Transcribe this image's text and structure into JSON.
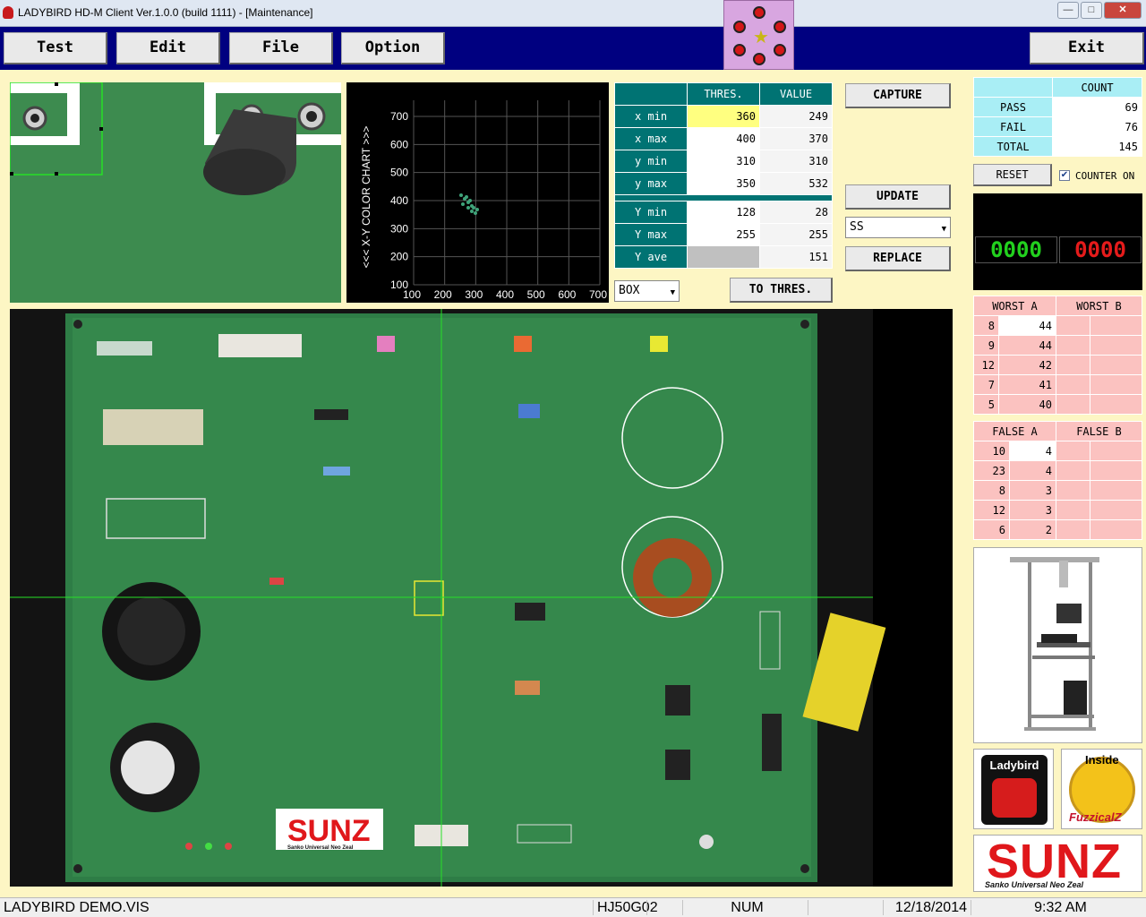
{
  "window": {
    "title": "LADYBIRD HD-M Client Ver.1.0.0  (build 1111) - [Maintenance]",
    "minimize": "—",
    "maximize": "□",
    "close": "✕"
  },
  "menu": {
    "test": "Test",
    "edit": "Edit",
    "file": "File",
    "option": "Option",
    "exit": "Exit"
  },
  "color_chart": {
    "ylabel": "<<<  X-Y COLOR CHART  >>>",
    "x_ticks": [
      "100",
      "200",
      "300",
      "400",
      "500",
      "600",
      "700"
    ],
    "y_ticks": [
      "700",
      "600",
      "500",
      "400",
      "300",
      "200",
      "100"
    ]
  },
  "thresholds": {
    "header_thres": "THRES.",
    "header_value": "VALUE",
    "rows_top": [
      {
        "label": "x min",
        "thres": "360",
        "value": "249"
      },
      {
        "label": "x max",
        "thres": "400",
        "value": "370"
      },
      {
        "label": "y min",
        "thres": "310",
        "value": "310"
      },
      {
        "label": "y max",
        "thres": "350",
        "value": "532"
      }
    ],
    "rows_bottom": [
      {
        "label": "Y min",
        "thres": "128",
        "value": "28"
      },
      {
        "label": "Y max",
        "thres": "255",
        "value": "255"
      },
      {
        "label": "Y ave",
        "thres": "",
        "value": "151"
      }
    ]
  },
  "controls": {
    "capture": "CAPTURE",
    "update": "UPDATE",
    "replace": "REPLACE",
    "to_thres": "TO THRES.",
    "box_select": "BOX",
    "ss_select": "SS"
  },
  "counter": {
    "header": "COUNT",
    "pass_label": "PASS",
    "pass_value": "69",
    "fail_label": "FAIL",
    "fail_value": "76",
    "total_label": "TOTAL",
    "total_value": "145",
    "reset": "RESET",
    "counter_on": "COUNTER ON",
    "counter_on_checked": true,
    "led_green": "0000",
    "led_red": "0000"
  },
  "worst": {
    "header_a": "WORST A",
    "header_b": "WORST B",
    "rows": [
      {
        "a1": "8",
        "a2": "44",
        "b1": "",
        "b2": ""
      },
      {
        "a1": "9",
        "a2": "44",
        "b1": "",
        "b2": ""
      },
      {
        "a1": "12",
        "a2": "42",
        "b1": "",
        "b2": ""
      },
      {
        "a1": "7",
        "a2": "41",
        "b1": "",
        "b2": ""
      },
      {
        "a1": "5",
        "a2": "40",
        "b1": "",
        "b2": ""
      }
    ]
  },
  "false_table": {
    "header_a": "FALSE A",
    "header_b": "FALSE B",
    "rows": [
      {
        "a1": "10",
        "a2": "4",
        "b1": "",
        "b2": ""
      },
      {
        "a1": "23",
        "a2": "4",
        "b1": "",
        "b2": ""
      },
      {
        "a1": "8",
        "a2": "3",
        "b1": "",
        "b2": ""
      },
      {
        "a1": "12",
        "a2": "3",
        "b1": "",
        "b2": ""
      },
      {
        "a1": "6",
        "a2": "2",
        "b1": "",
        "b2": ""
      }
    ]
  },
  "logos": {
    "ladybird": "Ladybird",
    "fuzzical_inside": "Inside",
    "fuzzical": "FuzzicalZ",
    "sunz": "SUNZ",
    "sunz_sub": "Sanko Universal Neo Zeal"
  },
  "board": {
    "sunz_label": "SUNZ",
    "sunz_sub": "Sanko Universal Neo Zeal"
  },
  "statusbar": {
    "file": "LADYBIRD DEMO.VIS",
    "code": "HJ50G02",
    "num": "NUM",
    "date": "12/18/2014",
    "time": "9:32 AM"
  },
  "colors": {
    "menubar": "#000080",
    "teal": "#007373",
    "background": "#fdf6c4",
    "led_green": "#22d11e",
    "led_red": "#e51b1b",
    "crosshair": "#27e027"
  }
}
